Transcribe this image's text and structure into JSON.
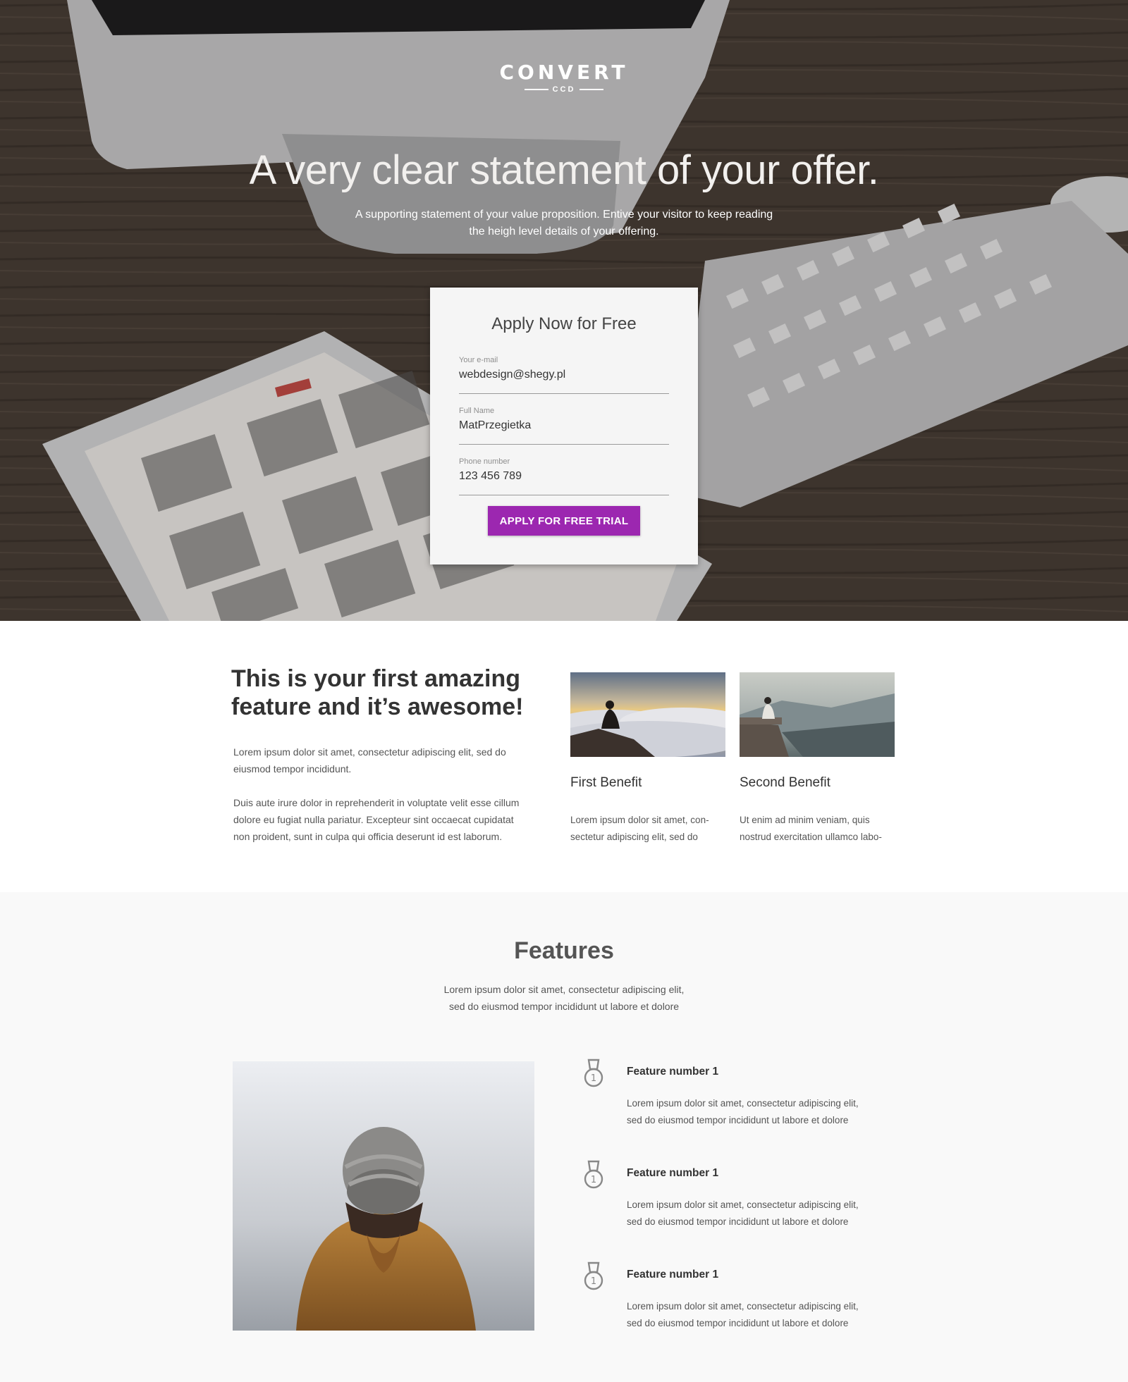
{
  "logo": {
    "main": "CONVERT",
    "sub": "CCD"
  },
  "hero": {
    "title": "A very clear statement of your offer.",
    "subtitle_line1": "A supporting statement of your value proposition. Entive your visitor to keep reading",
    "subtitle_line2": "the heigh level details of your offering."
  },
  "form": {
    "title": "Apply Now for Free",
    "fields": [
      {
        "label": "Your e-mail",
        "value": "webdesign@shegy.pl"
      },
      {
        "label": "Full Name",
        "value": "MatPrzegietka"
      },
      {
        "label": "Phone number",
        "value": "123 456 789"
      }
    ],
    "button_label": "APPLY FOR FREE TRIAL",
    "button_color": "#9c27b0"
  },
  "feature_intro": {
    "title_line1": "This is your first amazing",
    "title_line2": "feature and it’s awesome!",
    "p1_line1": "Lorem ipsum dolor sit amet, consectetur adipiscing elit, sed do",
    "p1_line2": "eiusmod tempor incididunt.",
    "p2_line1": "Duis aute irure dolor in reprehenderit in voluptate velit esse cillum",
    "p2_line2": "dolore eu fugiat nulla pariatur. Excepteur sint occaecat cupidatat",
    "p2_line3": "non proident, sunt in culpa qui officia deserunt id est laborum."
  },
  "benefits": [
    {
      "title": "First Benefit",
      "line1": "Lorem ipsum dolor sit amet, con-",
      "line2": "sectetur adipiscing elit, sed do"
    },
    {
      "title": "Second Benefit",
      "line1": "Ut enim ad minim veniam, quis",
      "line2": "nostrud exercitation ullamco labo-"
    }
  ],
  "features": {
    "title": "Features",
    "sub_line1": "Lorem ipsum dolor sit amet, consectetur adipiscing elit,",
    "sub_line2": "sed do eiusmod tempor incididunt ut labore et dolore",
    "items": [
      {
        "icon": "medal-icon",
        "badge": "1",
        "title": "Feature number 1",
        "line1": "Lorem ipsum dolor sit amet, consectetur adipiscing elit,",
        "line2": "sed do eiusmod tempor incididunt ut labore et dolore"
      },
      {
        "icon": "medal-icon",
        "badge": "1",
        "title": "Feature number 1",
        "line1": "Lorem ipsum dolor sit amet, consectetur adipiscing elit,",
        "line2": "sed do eiusmod tempor incididunt ut labore et dolore"
      },
      {
        "icon": "medal-icon",
        "badge": "1",
        "title": "Feature number 1",
        "line1": "Lorem ipsum dolor sit amet, consectetur adipiscing elit,",
        "line2": "sed do eiusmod tempor incididunt ut labore et dolore"
      }
    ]
  }
}
